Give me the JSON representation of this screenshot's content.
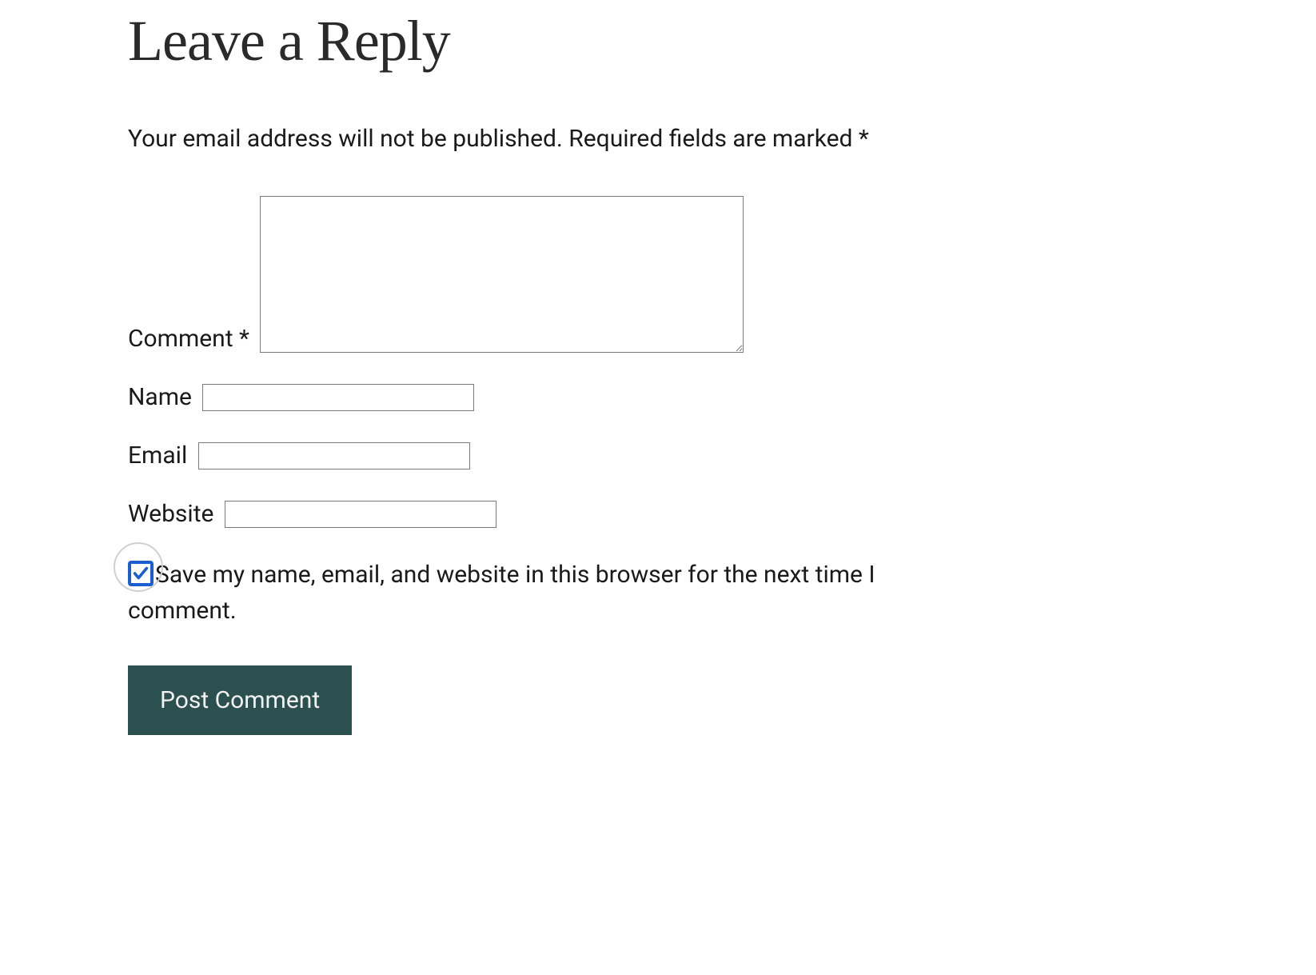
{
  "form": {
    "heading": "Leave a Reply",
    "notice_prefix": "Your email address will not be published.",
    "notice_required": "Required fields are marked ",
    "required_mark": "*",
    "fields": {
      "comment": {
        "label": "Comment ",
        "value": ""
      },
      "name": {
        "label": "Name",
        "value": ""
      },
      "email": {
        "label": "Email",
        "value": ""
      },
      "website": {
        "label": "Website",
        "value": ""
      }
    },
    "save_checkbox": {
      "checked": true,
      "label": "Save my name, email, and website in this browser for the next time I comment."
    },
    "submit_label": "Post Comment"
  }
}
